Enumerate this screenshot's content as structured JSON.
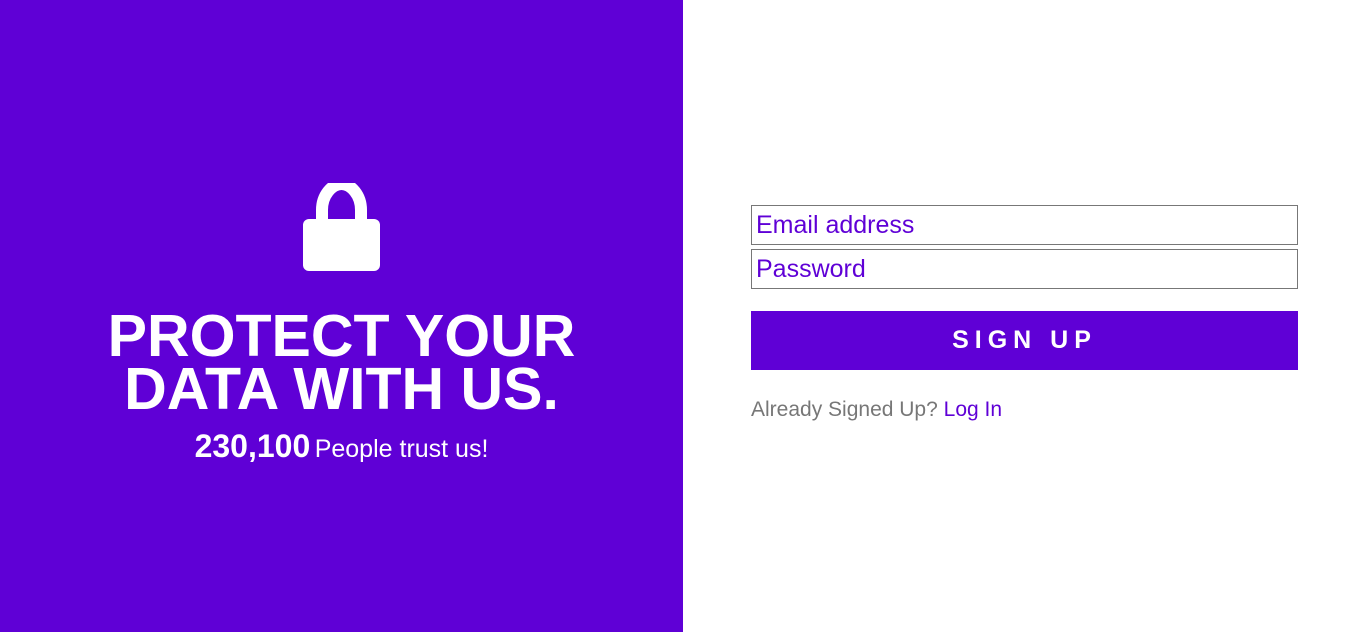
{
  "colors": {
    "brand": "#5f00d6",
    "white": "#ffffff",
    "muted_text": "#777777"
  },
  "hero": {
    "icon": "lock-icon",
    "headline_line1": "PROTECT YOUR",
    "headline_line2": "DATA WITH US.",
    "trust_count": "230,100",
    "trust_text": "People trust us!"
  },
  "form": {
    "email": {
      "placeholder": "Email address",
      "value": ""
    },
    "password": {
      "placeholder": "Password",
      "value": ""
    },
    "signup_label": "SIGN UP",
    "already_text": "Already Signed Up?",
    "login_label": "Log In"
  }
}
